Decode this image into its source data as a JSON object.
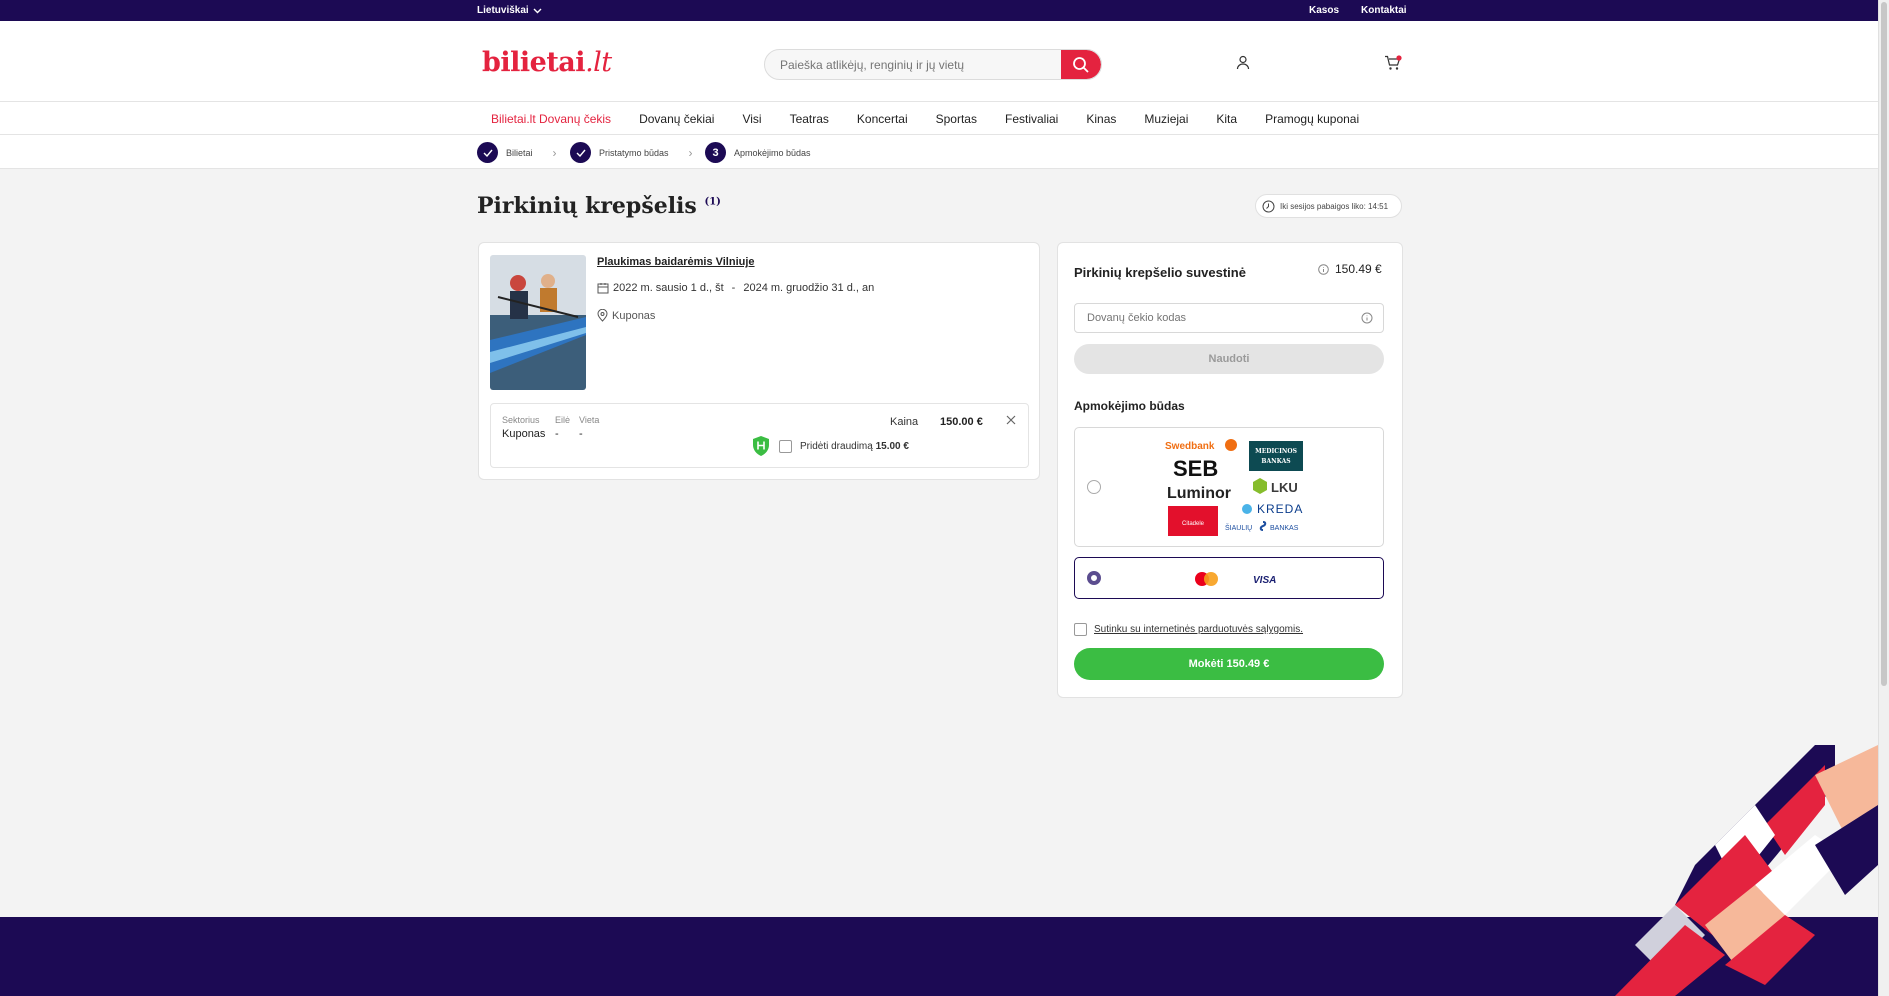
{
  "topbar": {
    "language": "Lietuviškai",
    "links": [
      "Kasos",
      "Kontaktai"
    ]
  },
  "header": {
    "logo_main": "bilietai",
    "logo_tld": ".lt",
    "search_placeholder": "Paieška atlikėjų, renginių ir jų vietų"
  },
  "nav": {
    "items": [
      "Bilietai.lt Dovanų čekis",
      "Dovanų čekiai",
      "Visi",
      "Teatras",
      "Koncertai",
      "Sportas",
      "Festivaliai",
      "Kinas",
      "Muziejai",
      "Kita",
      "Pramogų kuponai"
    ]
  },
  "steps": [
    {
      "label": "Bilietai",
      "marker": "check"
    },
    {
      "label": "Pristatymo būdas",
      "marker": "check"
    },
    {
      "label": "Apmokėjimo būdas",
      "marker": "3"
    }
  ],
  "cart": {
    "title": "Pirkinių krepšelis",
    "count": "(1)",
    "session_timer": "Iki sesijos pabaigos liko: 14:51",
    "item": {
      "title": "Plaukimas baidarėmis Vilniuje",
      "date_from": "2022 m. sausio 1 d., št",
      "date_separator": "-",
      "date_to": "2024 m. gruodžio 31 d., an",
      "location": "Kuponas",
      "ticket": {
        "sector_label": "Sektorius",
        "sector_value": "Kuponas",
        "row_label": "Eilė",
        "row_value": "-",
        "seat_label": "Vieta",
        "seat_value": "-",
        "price_label": "Kaina",
        "price_value": "150.00 €",
        "insurance_label": "Pridėti draudimą",
        "insurance_price": "15.00 €"
      }
    }
  },
  "summary": {
    "title": "Pirkinių krepšelio suvestinė",
    "total": "150.49 €",
    "gift_placeholder": "Dovanų čekio kodas",
    "use_button": "Naudoti",
    "payment_title": "Apmokėjimo būdas",
    "banks": {
      "swedbank": "Swedbank",
      "seb": "SEB",
      "luminor": "Luminor",
      "citadele": "Citadele",
      "medicinos_line1": "MEDICINOS",
      "medicinos_line2": "BANKAS",
      "lku": "LKU",
      "kreda": "KREDA",
      "siauliu": "ŠIAULIŲ",
      "siauliu_bankas": "BANKAS"
    },
    "cards": {
      "visa": "VISA"
    },
    "terms": "Sutinku su internetinės parduotuvės sąlygomis.",
    "pay_button": "Mokėti 150.49 €"
  },
  "colors": {
    "brand_navy": "#1c0a54",
    "brand_red": "#e4233f",
    "pay_green": "#3bbd43"
  }
}
